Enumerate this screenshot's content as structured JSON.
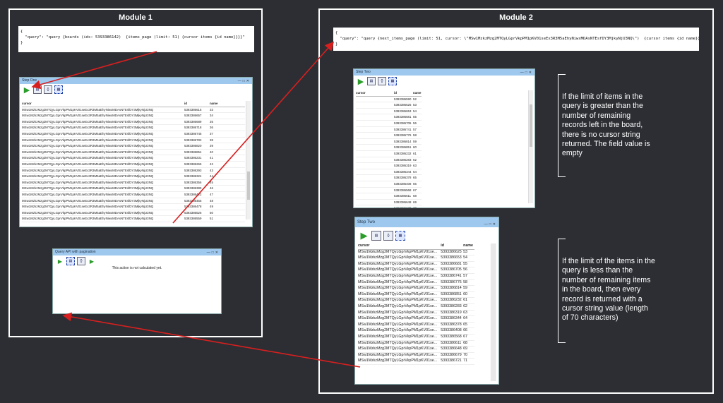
{
  "module1": {
    "title": "Module 1",
    "query_lines": [
      "{",
      "  \"query\": \"query {boards (ids: 5393386142)  {items_page (limit: 51) {cursor items {id name}}}}\"",
      "}"
    ],
    "step_window": {
      "title": "Step One",
      "columns": [
        "cursor",
        "id",
        "name"
      ],
      "rows": [
        [
          "MSw1MzkzMzg2MTQyLGprVkpPM1pKV01seEx3R3M5aEhyNiwxMDAsNTEsfDY3MjkyNjU3NQ",
          "5393386615",
          "33"
        ],
        [
          "MSw1MzkzMzg2MTQyLGprVkpPM1pKV01seEx3R3M5aEhyNiwxMDAsNTEsfDY3MjkyNjU3NQ",
          "5393386657",
          "34"
        ],
        [
          "MSw1MzkzMzg2MTQyLGprVkpPM1pKV01seEx3R3M5aEhyNiwxMDAsNTEsfDY3MjkyNjU3NQ",
          "5393386689",
          "35"
        ],
        [
          "MSw1MzkzMzg2MTQyLGprVkpPM1pKV01seEx3R3M5aEhyNiwxMDAsNTEsfDY3MjkyNjU3NQ",
          "5393386718",
          "36"
        ],
        [
          "MSw1MzkzMzg2MTQyLGprVkpPM1pKV01seEx3R3M5aEhyNiwxMDAsNTEsfDY3MjkyNjU3NQ",
          "5393386745",
          "37"
        ],
        [
          "MSw1MzkzMzg2MTQyLGprVkpPM1pKV01seEx3R3M5aEhyNiwxMDAsNTEsfDY3MjkyNjU3NQ",
          "5393386782",
          "38"
        ],
        [
          "MSw1MzkzMzg2MTQyLGprVkpPM1pKV01seEx3R3M5aEhyNiwxMDAsNTEsfDY3MjkyNjU3NQ",
          "5393386820",
          "39"
        ],
        [
          "MSw1MzkzMzg2MTQyLGprVkpPM1pKV01seEx3R3M5aEhyNiwxMDAsNTEsfDY3MjkyNjU3NQ",
          "5393386854",
          "40"
        ],
        [
          "MSw1MzkzMzg2MTQyLGprVkpPM1pKV01seEx3R3M5aEhyNiwxMDAsNTEsfDY3MjkyNjU3NQ",
          "5393386231",
          "41"
        ],
        [
          "MSw1MzkzMzg2MTQyLGprVkpPM1pKV01seEx3R3M5aEhyNiwxMDAsNTEsfDY3MjkyNjU3NQ",
          "5393386265",
          "42"
        ],
        [
          "MSw1MzkzMzg2MTQyLGprVkpPM1pKV01seEx3R3M5aEhyNiwxMDAsNTEsfDY3MjkyNjU3NQ",
          "5393386293",
          "43"
        ],
        [
          "MSw1MzkzMzg2MTQyLGprVkpPM1pKV01seEx3R3M5aEhyNiwxMDAsNTEsfDY3MjkyNjU3NQ",
          "5393386324",
          "44"
        ],
        [
          "MSw1MzkzMzg2MTQyLGprVkpPM1pKV01seEx3R3M5aEhyNiwxMDAsNTEsfDY3MjkyNjU3NQ",
          "5393386356",
          "45"
        ],
        [
          "MSw1MzkzMzg2MTQyLGprVkpPM1pKV01seEx3R3M5aEhyNiwxMDAsNTEsfDY3MjkyNjU3NQ",
          "5393386389",
          "46"
        ],
        [
          "MSw1MzkzMzg2MTQyLGprVkpPM1pKV01seEx3R3M5aEhyNiwxMDAsNTEsfDY3MjkyNjU3NQ",
          "5393386422",
          "47"
        ],
        [
          "MSw1MzkzMzg2MTQyLGprVkpPM1pKV01seEx3R3M5aEhyNiwxMDAsNTEsfDY3MjkyNjU3NQ",
          "5393386455",
          "48"
        ],
        [
          "MSw1MzkzMzg2MTQyLGprVkpPM1pKV01seEx3R3M5aEhyNiwxMDAsNTEsfDY3MjkyNjU3NQ",
          "5393386478",
          "49"
        ],
        [
          "MSw1MzkzMzg2MTQyLGprVkpPM1pKV01seEx3R3M5aEhyNiwxMDAsNTEsfDY3MjkyNjU3NQ",
          "5393386526",
          "50"
        ],
        [
          "MSw1MzkzMzg2MTQyLGprVkpPM1pKV01seEx3R3M5aEhyNiwxMDAsNTEsfDY3MjkyNjU3NQ",
          "5393386559",
          "51"
        ]
      ]
    },
    "api_window": {
      "title": "Query API with pagination",
      "message": "This action is not calculated yet."
    }
  },
  "module2": {
    "title": "Module 2",
    "query_lines": [
      "{",
      "  \"query\": \"query {next_items_page (limit: 51, cursor: \\\"MSw1MzkzMzg2MTQyLGprVkpPM1pKV01seEx3R3M5aEhyNiwxMDAsNTEsfDY3MjkyNjU3NQ\\\")  {cursor items {id name}}}\"",
      "}"
    ],
    "step_window_top": {
      "title": "Step Two",
      "columns": [
        "cursor",
        "id",
        "name"
      ],
      "rows": [
        [
          "",
          "5393386590",
          "52"
        ],
        [
          "",
          "5393386625",
          "53"
        ],
        [
          "",
          "5393386653",
          "54"
        ],
        [
          "",
          "5393386681",
          "55"
        ],
        [
          "",
          "5393386705",
          "56"
        ],
        [
          "",
          "5393386741",
          "57"
        ],
        [
          "",
          "5393386776",
          "58"
        ],
        [
          "",
          "5393386814",
          "59"
        ],
        [
          "",
          "5393386851",
          "60"
        ],
        [
          "",
          "5393386232",
          "61"
        ],
        [
          "",
          "5393386283",
          "62"
        ],
        [
          "",
          "5393386319",
          "63"
        ],
        [
          "",
          "5393386344",
          "64"
        ],
        [
          "",
          "5393386378",
          "65"
        ],
        [
          "",
          "5393386408",
          "66"
        ],
        [
          "",
          "5393386568",
          "67"
        ],
        [
          "",
          "5393386611",
          "68"
        ],
        [
          "",
          "5393386648",
          "69"
        ],
        [
          "",
          "5393386679",
          "70"
        ],
        [
          "",
          "5393386721",
          "71"
        ]
      ]
    },
    "step_window_bottom": {
      "title": "Step Two",
      "columns": [
        "cursor",
        "id",
        "name"
      ],
      "rows": [
        [
          "MSw1MzkzMzg2MTQyLGprVkpPM1pKV01se...",
          "5393386625",
          "53"
        ],
        [
          "MSw1MzkzMzg2MTQyLGprVkpPM1pKV01se...",
          "5393386653",
          "54"
        ],
        [
          "MSw1MzkzMzg2MTQyLGprVkpPM1pKV01se...",
          "5393386681",
          "55"
        ],
        [
          "MSw1MzkzMzg2MTQyLGprVkpPM1pKV01se...",
          "5393386705",
          "56"
        ],
        [
          "MSw1MzkzMzg2MTQyLGprVkpPM1pKV01se...",
          "5393386741",
          "57"
        ],
        [
          "MSw1MzkzMzg2MTQyLGprVkpPM1pKV01se...",
          "5393386776",
          "58"
        ],
        [
          "MSw1MzkzMzg2MTQyLGprVkpPM1pKV01se...",
          "5393386814",
          "59"
        ],
        [
          "MSw1MzkzMzg2MTQyLGprVkpPM1pKV01se...",
          "5393386851",
          "60"
        ],
        [
          "MSw1MzkzMzg2MTQyLGprVkpPM1pKV01se...",
          "5393386232",
          "61"
        ],
        [
          "MSw1MzkzMzg2MTQyLGprVkpPM1pKV01se...",
          "5393386283",
          "62"
        ],
        [
          "MSw1MzkzMzg2MTQyLGprVkpPM1pKV01se...",
          "5393386319",
          "63"
        ],
        [
          "MSw1MzkzMzg2MTQyLGprVkpPM1pKV01se...",
          "5393386344",
          "64"
        ],
        [
          "MSw1MzkzMzg2MTQyLGprVkpPM1pKV01se...",
          "5393386378",
          "65"
        ],
        [
          "MSw1MzkzMzg2MTQyLGprVkpPM1pKV01se...",
          "5393386408",
          "66"
        ],
        [
          "MSw1MzkzMzg2MTQyLGprVkpPM1pKV01se...",
          "5393386568",
          "67"
        ],
        [
          "MSw1MzkzMzg2MTQyLGprVkpPM1pKV01se...",
          "5393386611",
          "68"
        ],
        [
          "MSw1MzkzMzg2MTQyLGprVkpPM1pKV01se...",
          "5393386648",
          "69"
        ],
        [
          "MSw1MzkzMzg2MTQyLGprVkpPM1pKV01se...",
          "5393386679",
          "70"
        ],
        [
          "MSw1MzkzMzg2MTQyLGprVkpPM1pKV01se...",
          "5393386721",
          "71"
        ]
      ]
    }
  },
  "notes": {
    "top": "If the limit of items in the query is greater than the number of remaining records left in the board, there is no cursor string returned. The field value is empty",
    "bottom": "If the limit of the items in the query is less than the number of remaining items in the board, then every record is returned with a cursor string value (length of 70 characters)"
  },
  "toolbar_icons": [
    "run-icon",
    "table-view-icon",
    "json-view-icon",
    "query-edit-icon"
  ],
  "colors": {
    "background": "#2c2e33",
    "arrow": "#d81f1f",
    "titlebar": "#9fc8ee",
    "run": "#2a9d2a"
  }
}
